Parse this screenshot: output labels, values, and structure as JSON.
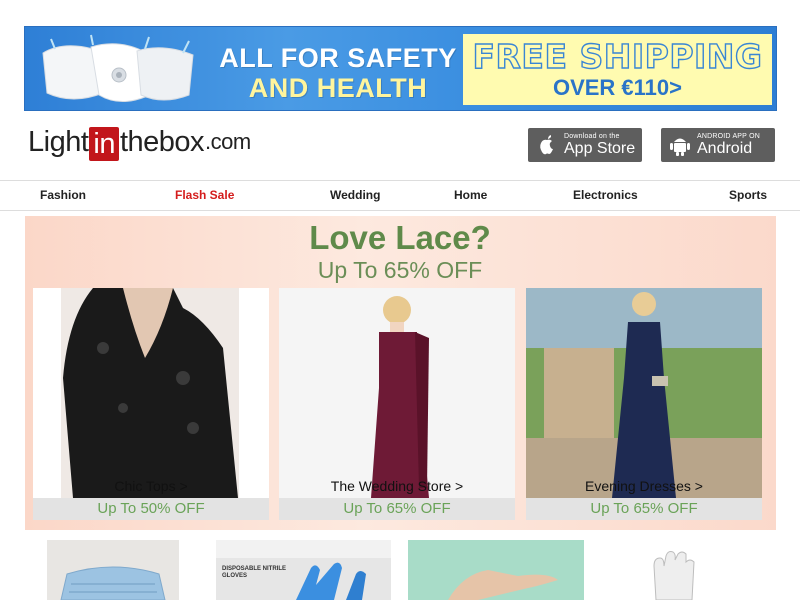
{
  "banner": {
    "left_line1": "ALL FOR SAFETY",
    "left_line2": "AND HEALTH",
    "shipping_line1": "FREE SHIPPING",
    "shipping_line2": "OVER €110>"
  },
  "logo": {
    "part1": "Light",
    "part2": "in",
    "part3": "thebox",
    "part4": ".com"
  },
  "apps": {
    "appstore_small": "Download on the",
    "appstore_big": "App Store",
    "android_small": "ANDROID APP ON",
    "android_big": "Android"
  },
  "nav": [
    "Fashion",
    "Flash Sale",
    "Wedding",
    "Home",
    "Electronics",
    "Sports"
  ],
  "promo": {
    "title": "Love Lace?",
    "subtitle": "Up To 65% OFF",
    "cards": [
      {
        "label": "Chic Tops >",
        "offer": "Up To 50% OFF"
      },
      {
        "label": "The Wedding Store >",
        "offer": "Up To 65% OFF"
      },
      {
        "label": "Evening Dresses >",
        "offer": "Up To 65% OFF"
      }
    ]
  },
  "colors": {
    "flash_sale": "#d41c1c",
    "promo_green": "#5f8a4a",
    "brand_red": "#c2161b",
    "banner_blue": "#2e7fd6"
  }
}
